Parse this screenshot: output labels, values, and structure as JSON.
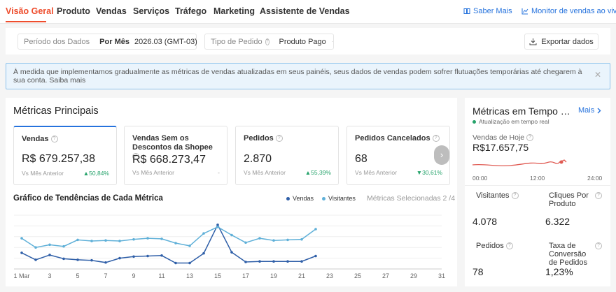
{
  "nav": {
    "tabs": [
      "Visão Geral",
      "Produto",
      "Vendas",
      "Serviços",
      "Tráfego",
      "Marketing",
      "Assistente de Vendas"
    ],
    "learn_more": "Saber Mais",
    "live_monitor": "Monitor de vendas ao vivo"
  },
  "filters": {
    "period_label": "Período dos Dados",
    "period_mode": "Por Mês",
    "period_value": "2026.03 (GMT-03)",
    "order_type_label": "Tipo de Pedido",
    "order_type_value": "Produto Pago",
    "export_label": "Exportar dados"
  },
  "notice": {
    "text": "À medida que implementamos gradualmente as métricas de vendas atualizadas em seus painéis, seus dados de vendas podem sofrer flutuações temporárias até chegarem à sua conta. Saiba mais"
  },
  "metrics": {
    "title": "Métricas Principais",
    "cards": [
      {
        "title": "Vendas",
        "value": "R$ 679.257,38",
        "compare": "Vs Mês Anterior",
        "change": "▲50,84%"
      },
      {
        "title": "Vendas Sem os Descontos da Shopee",
        "value": "R$ 668.273,47",
        "compare": "Vs Mês Anterior",
        "change": "-"
      },
      {
        "title": "Pedidos",
        "value": "2.870",
        "compare": "Vs Mês Anterior",
        "change": "▲55,39%"
      },
      {
        "title": "Pedidos Cancelados",
        "value": "68",
        "compare": "Vs Mês Anterior",
        "change": "▼30,61%"
      }
    ]
  },
  "trend": {
    "title": "Gráfico de Tendências de Cada Métrica",
    "selected": "Métricas Selecionadas 2 /4"
  },
  "chart_data": {
    "type": "line",
    "x_ticks": [
      "1 Mar",
      "3",
      "5",
      "7",
      "9",
      "11",
      "13",
      "15",
      "17",
      "19",
      "21",
      "23",
      "25",
      "27",
      "29",
      "31"
    ],
    "x": [
      1,
      2,
      3,
      4,
      5,
      6,
      7,
      8,
      9,
      10,
      11,
      12,
      13,
      14,
      15,
      16,
      17,
      18,
      19,
      20,
      21,
      22
    ],
    "xlim": [
      1,
      31
    ],
    "ylim": [
      0,
      100
    ],
    "series": [
      {
        "name": "Vendas",
        "color": "#2f5fa8",
        "values": [
          30,
          17,
          26,
          19,
          17,
          16,
          12,
          20,
          23,
          24,
          25,
          11,
          11,
          29,
          82,
          31,
          13,
          14,
          14,
          14,
          14,
          24
        ]
      },
      {
        "name": "Visitantes",
        "color": "#5fb0d8",
        "values": [
          57,
          40,
          45,
          42,
          54,
          52,
          53,
          52,
          55,
          57,
          56,
          48,
          43,
          66,
          78,
          63,
          49,
          57,
          53,
          54,
          55,
          74
        ]
      }
    ]
  },
  "realtime": {
    "title": "Métricas em Tempo Real",
    "more": "Mais",
    "updated": "Atualização em tempo real",
    "today_label": "Vendas de Hoje",
    "today_value": "R$17.657,75",
    "x_ticks": [
      "00:00",
      "12:00",
      "24:00"
    ],
    "stats": [
      {
        "label": "Visitantes",
        "value": "4.078"
      },
      {
        "label": "Cliques Por Produto",
        "value": "6.322"
      },
      {
        "label": "Pedidos",
        "value": "78"
      },
      {
        "label": "Taxa de Conversão de Pedidos",
        "value": "1,23%"
      }
    ]
  },
  "colors": {
    "accent": "#ee4d2d",
    "link": "#2673dd",
    "up": "#26a36b",
    "spark": "#e05a52"
  }
}
